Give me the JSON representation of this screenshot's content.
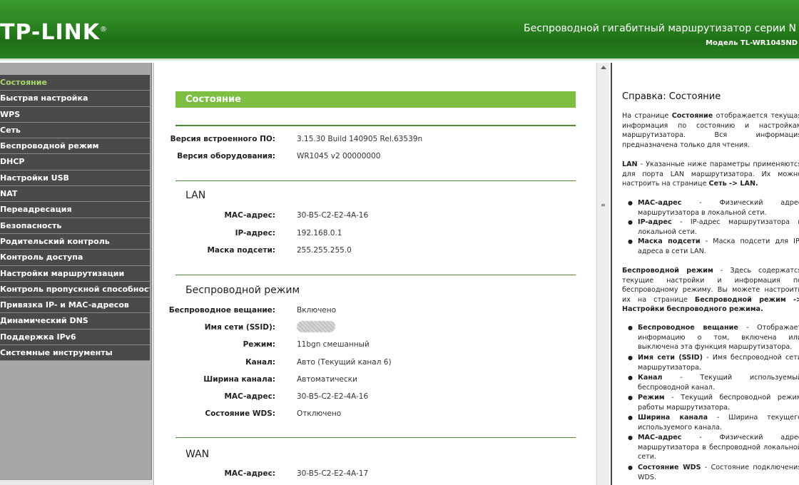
{
  "header": {
    "logo": "TP-LINK",
    "logo_mark": "®",
    "product": "Беспроводной гигабитный маршрутизатор серии N",
    "model": "Модель TL-WR1045ND"
  },
  "sidebar": {
    "items": [
      {
        "label": "Состояние"
      },
      {
        "label": "Быстрая настройка"
      },
      {
        "label": "WPS"
      },
      {
        "label": "Сеть"
      },
      {
        "label": "Беспроводной режим"
      },
      {
        "label": "DHCP"
      },
      {
        "label": "Настройки USB"
      },
      {
        "label": "NAT"
      },
      {
        "label": "Переадресация"
      },
      {
        "label": "Безопасность"
      },
      {
        "label": "Родительский контроль"
      },
      {
        "label": "Контроль доступа"
      },
      {
        "label": "Настройки маршрутизации"
      },
      {
        "label": "Контроль пропускной способности"
      },
      {
        "label": "Привязка IP- и MAC-адресов"
      },
      {
        "label": "Динамический DNS"
      },
      {
        "label": "Поддержка IPv6"
      },
      {
        "label": "Системные инструменты"
      }
    ]
  },
  "main": {
    "title": "Состояние",
    "firmware_label": "Версия встроенного ПО:",
    "firmware_value": "3.15.30 Build 140905 Rel.63539n",
    "hardware_label": "Версия оборудования:",
    "hardware_value": "WR1045 v2 00000000",
    "lan": {
      "title": "LAN",
      "mac_label": "MAC-адрес:",
      "mac_value": "30-B5-C2-E2-4A-16",
      "ip_label": "IP-адрес:",
      "ip_value": "192.168.0.1",
      "mask_label": "Маска подсети:",
      "mask_value": "255.255.255.0"
    },
    "wireless": {
      "title": "Беспроводной режим",
      "broadcast_label": "Беспроводное вещание:",
      "broadcast_value": "Включено",
      "ssid_label": "Имя сети (SSID):",
      "mode_label": "Режим:",
      "mode_value": "11bgn смешанный",
      "channel_label": "Канал:",
      "channel_value": "Авто (Текущий канал 6)",
      "width_label": "Ширина канала:",
      "width_value": "Автоматически",
      "mac_label": "MAC-адрес:",
      "mac_value": "30-B5-C2-E2-4A-16",
      "wds_label": "Состояние WDS:",
      "wds_value": "Отключено"
    },
    "wan": {
      "title": "WAN",
      "mac_label": "MAC-адрес:",
      "mac_value": "30-B5-C2-E2-4A-17"
    }
  },
  "help": {
    "title": "Справка: Состояние",
    "intro_1": "На странице",
    "intro_bold": "Состояние",
    "intro_2": "отображается текущая информация по состоянию и настройкам маршрутизатора. Вся информация предназначена только для чтения.",
    "lan_bold": "LAN",
    "lan_text": "- Указанные ниже параметры применяются для порта LAN маршрутизатора. Их можно настроить на странице",
    "lan_link": "Сеть -> LAN.",
    "lan_bullets": [
      {
        "b": "MAC-адрес",
        "t": "- Физический адрес маршрутизатора в локальной сети."
      },
      {
        "b": "IP-адрес",
        "t": "- IP-адрес маршрутизатора в локальной сети."
      },
      {
        "b": "Маска подсети",
        "t": "- Маска подсети для IP-адреса в сети LAN."
      }
    ],
    "wl_bold": "Беспроводной режим",
    "wl_text": "- Здесь содержатся текущие настройки и информация по беспроводному режиму. Вы можете настроить их на странице",
    "wl_link": "Беспроводной режим -> Настройки беспроводного режима.",
    "wl_bullets": [
      {
        "b": "Беспроводное вещание",
        "t": "- Отображает информацию о том, включена или выключена эта функция маршрутизатора."
      },
      {
        "b": "Имя сети (SSID)",
        "t": "- Имя беспроводной сети маршрутизатора."
      },
      {
        "b": "Канал",
        "t": "- Текущий используемый беспроводной канал."
      },
      {
        "b": "Режим",
        "t": "- Текущий беспроводной режим работы маршрутизатора."
      },
      {
        "b": "Ширина канала",
        "t": "- Ширина текущего используемого канала."
      },
      {
        "b": "MAC-адрес",
        "t": "- Физический адрес маршрутизатора в беспроводной локальной сети."
      },
      {
        "b": "Состояние WDS",
        "t": "- Состояние подключения WDS."
      }
    ]
  }
}
